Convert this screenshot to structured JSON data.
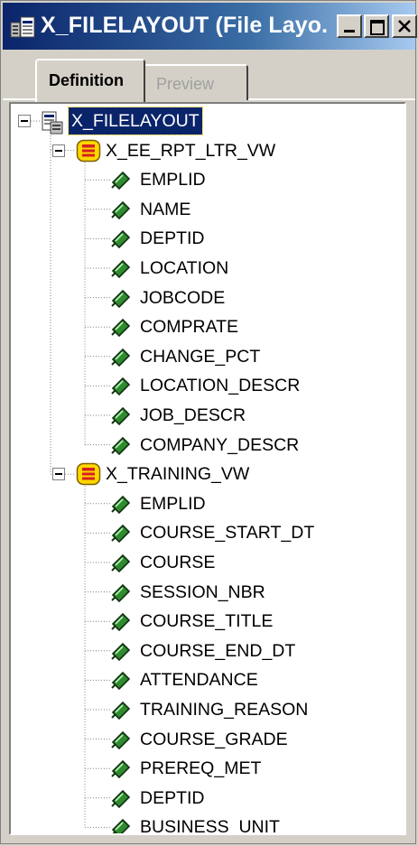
{
  "window": {
    "title": "X_FILELAYOUT (File Layo..."
  },
  "tabs": [
    {
      "label": "Definition",
      "active": true
    },
    {
      "label": "Preview",
      "active": false
    }
  ],
  "tree": {
    "root": {
      "label": "X_FILELAYOUT",
      "icon": "file-layout-icon",
      "selected": true
    },
    "records": [
      {
        "label": "X_EE_RPT_LTR_VW",
        "icon": "record-icon",
        "fields": [
          "EMPLID",
          "NAME",
          "DEPTID",
          "LOCATION",
          "JOBCODE",
          "COMPRATE",
          "CHANGE_PCT",
          "LOCATION_DESCR",
          "JOB_DESCR",
          "COMPANY_DESCR"
        ]
      },
      {
        "label": "X_TRAINING_VW",
        "icon": "record-icon",
        "fields": [
          "EMPLID",
          "COURSE_START_DT",
          "COURSE",
          "SESSION_NBR",
          "COURSE_TITLE",
          "COURSE_END_DT",
          "ATTENDANCE",
          "TRAINING_REASON",
          "COURSE_GRADE",
          "PREREQ_MET",
          "DEPTID",
          "BUSINESS_UNIT"
        ]
      }
    ]
  },
  "colors": {
    "titlebar_start": "#0a246a",
    "titlebar_end": "#a6caf0",
    "selection": "#0a246a",
    "field_icon_green": "#2e8b2e",
    "record_icon_yellow": "#ffd700",
    "record_icon_red": "#d42020"
  }
}
